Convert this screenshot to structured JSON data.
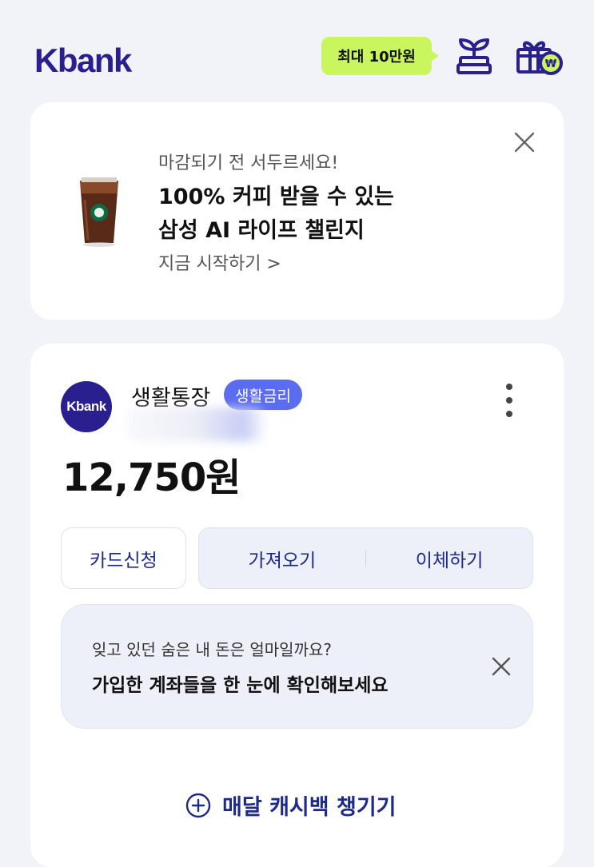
{
  "header": {
    "logo": "Kbank",
    "promo_label": "최대 10만원"
  },
  "banner": {
    "subtitle": "마감되기 전 서두르세요!",
    "title_line1": "100% 커피 받을 수 있는",
    "title_line2": "삼성 AI 라이프 챌린지",
    "link": "지금 시작하기 >"
  },
  "account": {
    "avatar_text": "Kbank",
    "name": "생활통장",
    "badge": "생활금리",
    "balance": "12,750원",
    "buttons": {
      "card_apply": "카드신청",
      "bring": "가져오기",
      "transfer": "이체하기"
    },
    "notice": {
      "subtitle": "잊고 있던 숨은 내 돈은 얼마일까요?",
      "title": "가입한 계좌들을 한 눈에 확인해보세요"
    },
    "cashback": "매달 캐시백 챙기기"
  },
  "colors": {
    "brand": "#2a1f8f",
    "promo_bg": "#c9f55e",
    "badge_bg": "#5a6cf0",
    "background": "#f2f3f8"
  },
  "icons": [
    "sprout-icon",
    "gift-won-icon",
    "close-icon",
    "more-vertical-icon",
    "plus-circle-icon"
  ]
}
